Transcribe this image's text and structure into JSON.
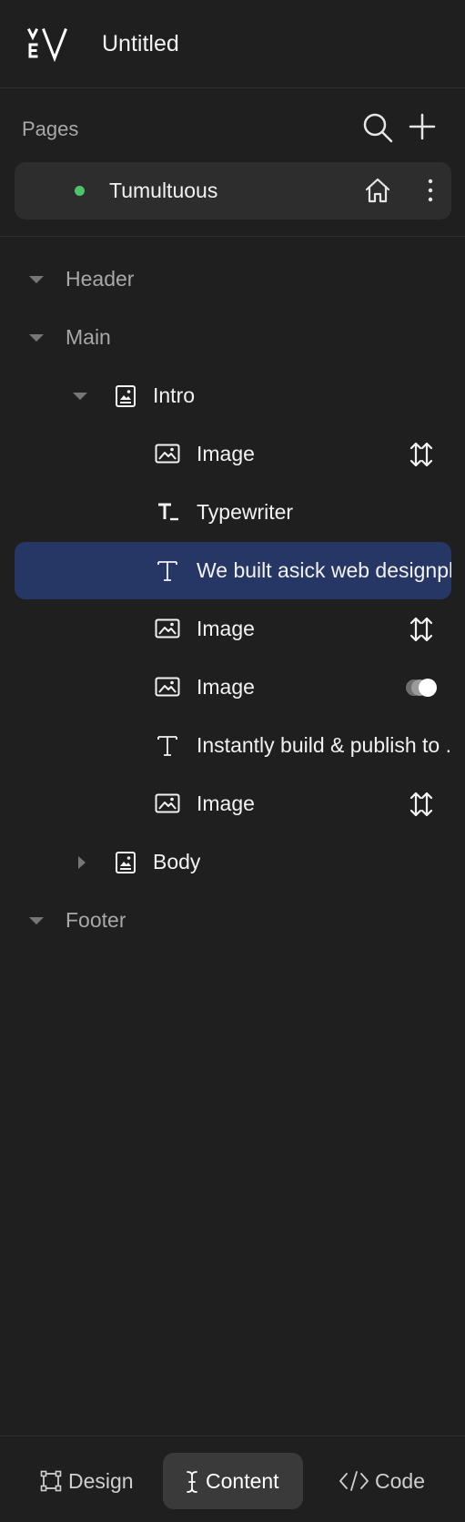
{
  "app": {
    "title": "Untitled"
  },
  "pages": {
    "label": "Pages",
    "items": [
      {
        "name": "Tumultuous",
        "status_color": "#4cc46a"
      }
    ]
  },
  "tree": {
    "header": "Header",
    "main": "Main",
    "intro": "Intro",
    "intro_children": [
      {
        "label": "Image",
        "icon": "image-icon",
        "action": "resize-icon"
      },
      {
        "label": "Typewriter",
        "icon": "typewriter-icon"
      },
      {
        "label": "We built asick web designpl.",
        "icon": "text-icon",
        "selected": true
      },
      {
        "label": "Image",
        "icon": "image-icon",
        "action": "resize-icon"
      },
      {
        "label": "Image",
        "icon": "image-icon",
        "action": "toggle-icon"
      },
      {
        "label": "Instantly build & publish to .",
        "icon": "text-icon"
      },
      {
        "label": "Image",
        "icon": "image-icon",
        "action": "resize-icon"
      }
    ],
    "body": "Body",
    "footer": "Footer"
  },
  "bottom_tabs": [
    {
      "label": "Design",
      "icon": "design-icon"
    },
    {
      "label": "Content",
      "icon": "content-cursor-icon",
      "active": true
    },
    {
      "label": "Code",
      "icon": "code-icon"
    }
  ],
  "colors": {
    "accent": "#263766",
    "background": "#1f1f1f",
    "status": "#4cc46a"
  }
}
